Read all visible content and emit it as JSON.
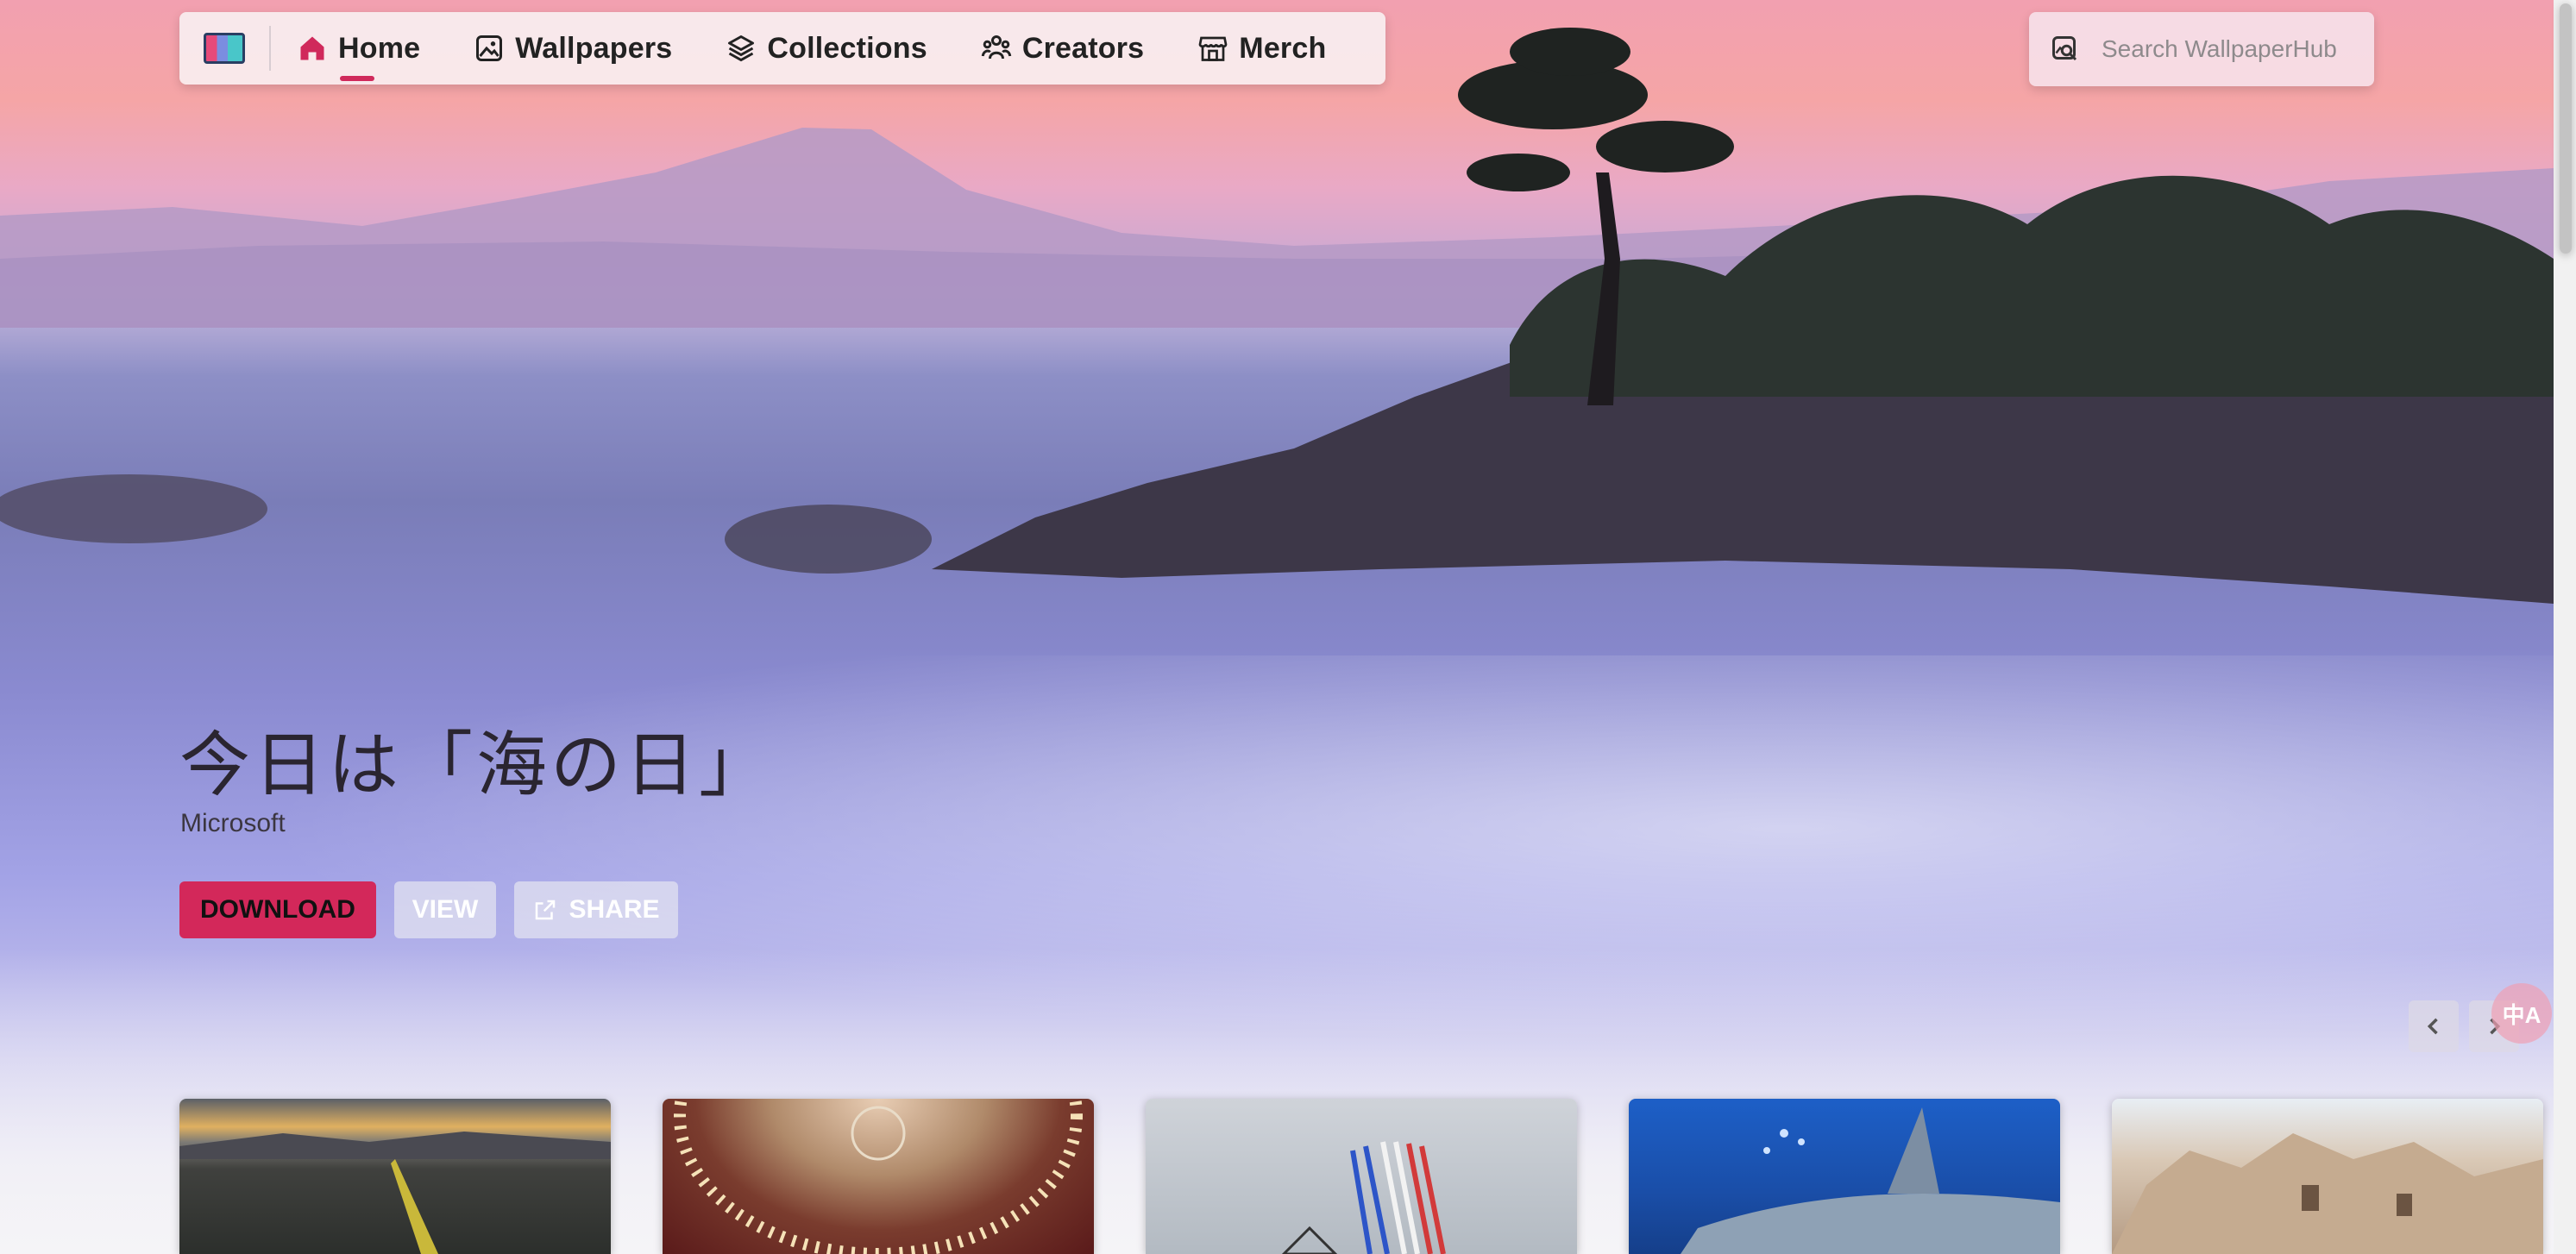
{
  "nav": {
    "logo": "wallpaperhub-logo",
    "items": [
      {
        "label": "Home",
        "icon": "home-icon",
        "active": true
      },
      {
        "label": "Wallpapers",
        "icon": "image-icon"
      },
      {
        "label": "Collections",
        "icon": "layers-icon"
      },
      {
        "label": "Creators",
        "icon": "people-icon"
      },
      {
        "label": "Merch",
        "icon": "store-icon"
      }
    ],
    "accent": "#d0295b"
  },
  "search": {
    "placeholder": "Search WallpaperHub",
    "icon": "image-search-icon"
  },
  "hero": {
    "title": "今日は「海の日」",
    "author": "Microsoft",
    "buttons": {
      "download": "DOWNLOAD",
      "view": "VIEW",
      "share": "SHARE"
    },
    "translate_badge": "中A"
  },
  "thumbnails": [
    {
      "name": "vineyard-sunset"
    },
    {
      "name": "opera-house-ceiling"
    },
    {
      "name": "air-show-jets"
    },
    {
      "name": "shark-underwater"
    },
    {
      "name": "cappadocia-rocks"
    }
  ]
}
